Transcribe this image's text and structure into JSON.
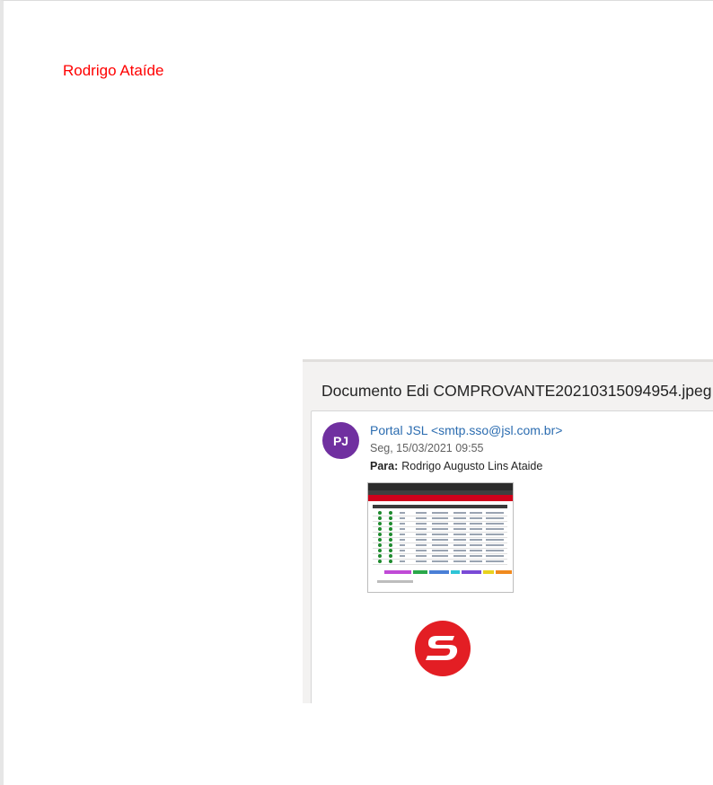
{
  "sender_heading": "Rodrigo Ataíde",
  "email": {
    "subject": "Documento Edi COMPROVANTE20210315094954.jpeg",
    "avatar_initials": "PJ",
    "avatar_color": "#7030a0",
    "from": "Portal JSL <smtp.sso@jsl.com.br>",
    "date": "Seg, 15/03/2021 09:55",
    "to_label": "Para:",
    "to_value": "Rodrigo Augusto Lins Ataide",
    "attachment_icon": "image-thumbnail",
    "logo_icon": "jsl-logo-icon",
    "brand_color": "#e31e24"
  }
}
